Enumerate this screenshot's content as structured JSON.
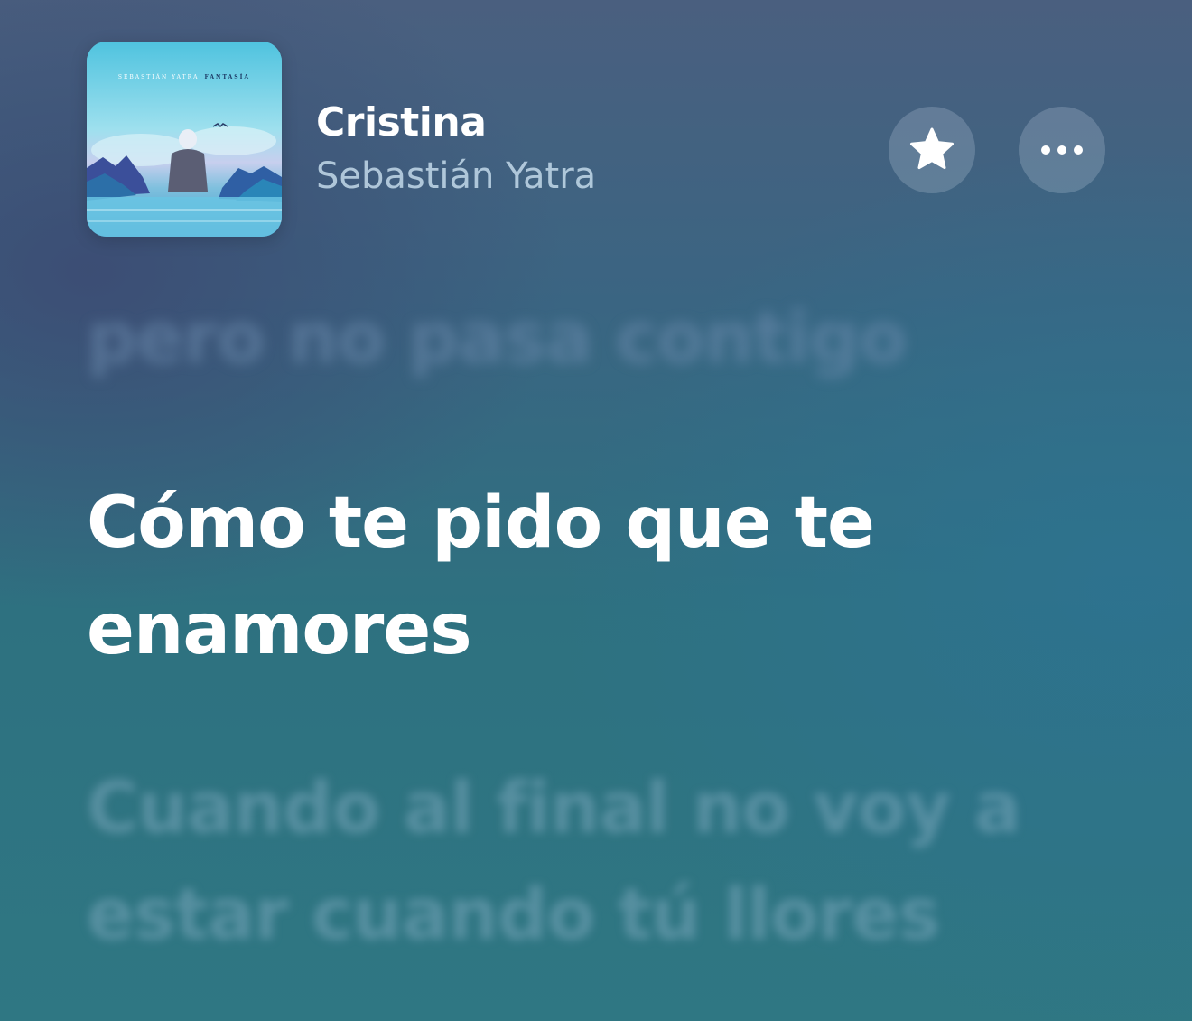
{
  "now_playing": {
    "album_art": {
      "artist_text": "SEBASTIÁN YATRA",
      "album_text": "FANTASÍA"
    },
    "title": "Cristina",
    "artist": "Sebastián Yatra",
    "favorite_icon": "star-icon",
    "more_icon": "ellipsis-icon"
  },
  "lyrics": {
    "previous_line": "pero no pasa contigo",
    "current_line": "Cómo te pido que te enamores",
    "next_line": "Cuando al final no voy a estar cuando tú llores"
  },
  "colors": {
    "accent_text": "#ffffff",
    "artist_text": "#c8deee",
    "button_bg": "#d2e1ee"
  }
}
